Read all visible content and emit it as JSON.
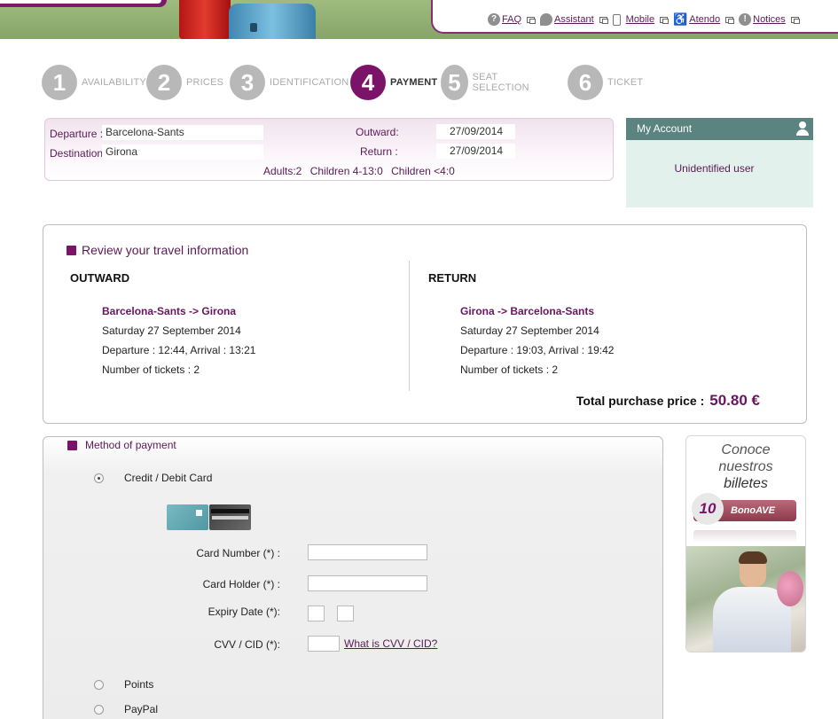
{
  "header": {
    "links": [
      {
        "label": "FAQ",
        "icon": "question-icon"
      },
      {
        "label": "Assistant",
        "icon": "chat-bubble-icon"
      },
      {
        "label": "Mobile",
        "icon": "mobile-icon"
      },
      {
        "label": "Atendo",
        "icon": "accessibility-icon"
      },
      {
        "label": "Notices",
        "icon": "alert-icon"
      }
    ]
  },
  "steps": [
    {
      "number": "1",
      "label": "AVAILABILITY",
      "active": false
    },
    {
      "number": "2",
      "label": "PRICES",
      "active": false
    },
    {
      "number": "3",
      "label": "IDENTIFICATION",
      "active": false
    },
    {
      "number": "4",
      "label": "PAYMENT",
      "active": true
    },
    {
      "number": "5",
      "label": "SEAT SELECTION",
      "active": false
    },
    {
      "number": "6",
      "label": "TICKET",
      "active": false
    }
  ],
  "summary": {
    "departure_label": "Departure :",
    "departure_value": "Barcelona-Sants",
    "destination_label": "Destination",
    "destination_value": "Girona",
    "outward_label": "Outward:",
    "outward_value": "27/09/2014",
    "return_label": "Return :",
    "return_value": "27/09/2014",
    "adults": "Adults:2",
    "children_4_13": "Children 4-13:0",
    "children_under_4": "Children <4:0"
  },
  "account": {
    "title": "My Account",
    "user": "Unidentified user"
  },
  "review": {
    "title": "Review your travel information",
    "outward": {
      "heading": "OUTWARD",
      "route": "Barcelona-Sants -> Girona",
      "date": "Saturday 27 September 2014",
      "times": "Departure : 12:44, Arrival : 13:21",
      "tickets": "Number of tickets : 2"
    },
    "return": {
      "heading": "RETURN",
      "route": "Girona -> Barcelona-Sants",
      "date": "Saturday 27 September 2014",
      "times": "Departure : 19:03, Arrival : 19:42",
      "tickets": "Number of tickets : 2"
    },
    "total_label": "Total purchase price :",
    "total_value": "50.80 €"
  },
  "payment": {
    "title": "Method of payment",
    "options": {
      "card": "Credit / Debit Card",
      "points": "Points",
      "paypal": "PayPal"
    },
    "selected": "card",
    "fields": {
      "card_number_label": "Card Number (*) :",
      "card_number_value": "",
      "card_holder_label": "Card Holder (*) :",
      "card_holder_value": "",
      "expiry_label": "Expiry Date (*):",
      "expiry_month": "",
      "expiry_year": "",
      "cvv_label": "CVV / CID (*):",
      "cvv_value": "",
      "cvv_link": "What is CVV / CID?"
    }
  },
  "promo": {
    "line1": "Conoce",
    "line2": "nuestros",
    "line3": "billetes",
    "badge_number": "10",
    "badge_text": "BonoAVE"
  },
  "colors": {
    "brand_purple": "#7b1368",
    "account_header": "#5b8380",
    "account_bg": "#e3f1ec"
  }
}
